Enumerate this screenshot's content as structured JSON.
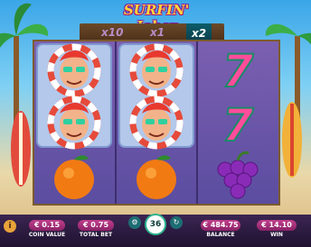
{
  "game": {
    "title": "SURFIN' Joker"
  },
  "multipliers": [
    "x10",
    "x1",
    "x2"
  ],
  "grid": {
    "reels": [
      [
        "joker-wild",
        "joker-wild",
        "orange"
      ],
      [
        "joker-wild",
        "joker-wild",
        "orange"
      ],
      [
        "seven",
        "seven",
        "grapes"
      ]
    ]
  },
  "controls": {
    "coin_value": {
      "value": "€ 0.15",
      "label": "COIN VALUE"
    },
    "total_bet": {
      "value": "€ 0.75",
      "label": "TOTAL BET"
    },
    "spin": {
      "count": "36"
    },
    "balance": {
      "value": "€ 484.75",
      "label": "BALANCE"
    },
    "win": {
      "value": "€ 14.10",
      "label": "WIN"
    },
    "info_label": "i"
  },
  "colors": {
    "accent_pink": "#c23f8c",
    "frame_brown": "#7c5b2e",
    "grid_purple": "#6a55a8",
    "seven_pink": "#ff4d9a"
  }
}
